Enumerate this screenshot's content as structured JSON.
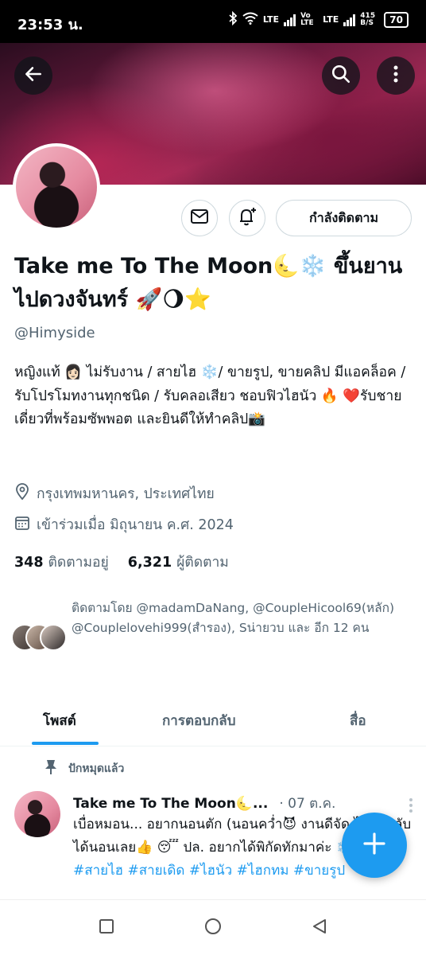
{
  "status_bar": {
    "time": "23:53 น.",
    "network_1": "LTE",
    "network_2": "Vo LTE",
    "network_3": "LTE",
    "data_speed": "415 B/S",
    "battery": "70"
  },
  "profile": {
    "display_name": "Take me To The Moon🌜❄️ ขึ้นยานไปดวงจันทร์ 🚀🌖⭐",
    "handle": "@Himyside",
    "bio": "หญิงแท้ 👩🏻 ไม่รับงาน / สายไฮ ❄️/ ขายรูป, ขายคลิป มีแอคล็อค /รับโปรโมทงานทุกชนิด / รับคลอเสียว ชอบฟิวไฮนัว 🔥 ❤️รับชายเดี่ยวที่พร้อมซัพพอต และยินดีให้ทำคลิป📸",
    "location": "กรุงเทพมหานคร, ประเทศไทย",
    "joined": "เข้าร่วมเมื่อ มิถุนายน ค.ศ. 2024",
    "following_count": "348",
    "following_label": "ติดตามอยู่",
    "followers_count": "6,321",
    "followers_label": "ผู้ติดตาม",
    "followed_by": "ติดตามโดย @madamDaNang, @CoupleHicool69(หลัก) @Couplelovehi999(สำรอง), Sน่ายวบ และ อีก 12 คน"
  },
  "actions": {
    "follow_label": "กำลังติดตาม",
    "message_icon": "mail-icon",
    "notify_icon": "bell-plus-icon"
  },
  "tabs": [
    {
      "label": "โพสต์",
      "active": true
    },
    {
      "label": "การตอบกลับ",
      "active": false
    },
    {
      "label": "สื่อ",
      "active": false
    }
  ],
  "pinned_post": {
    "pinned_label": "ปักหมุดแล้ว",
    "author": "Take me To The Moon🌜...",
    "date": "· 07 ต.ค.",
    "text": "เบื่อหมอน... อยากนอนตัก (นอนคว่ำ😈 งานดีจัด ไม่ได้หลับ ได้นอนเลย👍 😴 ปล. อยากได้พิกัดทักมาค่ะ ❄️❤️",
    "tags": "#สายไฮ #สายเดิด #ไฮนัว #ไฮกทม #ขายรูป"
  },
  "colors": {
    "accent": "#1d9bf0",
    "text_primary": "#0f1419",
    "text_secondary": "#536471"
  }
}
